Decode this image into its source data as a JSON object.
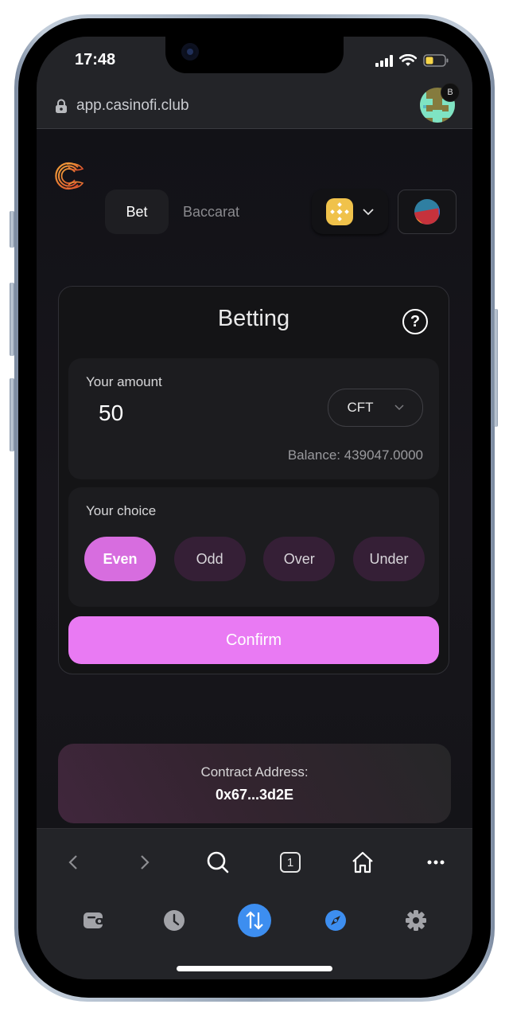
{
  "status_bar": {
    "time": "17:48",
    "battery_color": "#f7d649"
  },
  "browser": {
    "url": "app.casinofi.club",
    "profile_badge": "B",
    "tab_count": "1"
  },
  "app_nav": {
    "tabs": [
      {
        "label": "Bet",
        "active": true
      },
      {
        "label": "Baccarat",
        "active": false
      }
    ],
    "network": "BNB Chain",
    "brand_color": "#e97a2c"
  },
  "betting": {
    "title": "Betting",
    "amount_label": "Your amount",
    "amount_value": "50",
    "token": "CFT",
    "balance": "Balance: 439047.0000",
    "choice_label": "Your choice",
    "choices": [
      {
        "label": "Even",
        "selected": true
      },
      {
        "label": "Odd",
        "selected": false
      },
      {
        "label": "Over",
        "selected": false
      },
      {
        "label": "Under",
        "selected": false
      }
    ],
    "confirm_label": "Confirm",
    "accent_color": "#e97af3"
  },
  "contract": {
    "label": "Contract Address:",
    "address": "0x67...3d2E"
  },
  "browser_nav": {
    "items": [
      "back",
      "forward",
      "search",
      "tabs",
      "home",
      "more"
    ]
  },
  "dock": {
    "items": [
      "wallet",
      "history",
      "swap",
      "discover",
      "settings"
    ],
    "active_color": "#3d8ef0"
  }
}
